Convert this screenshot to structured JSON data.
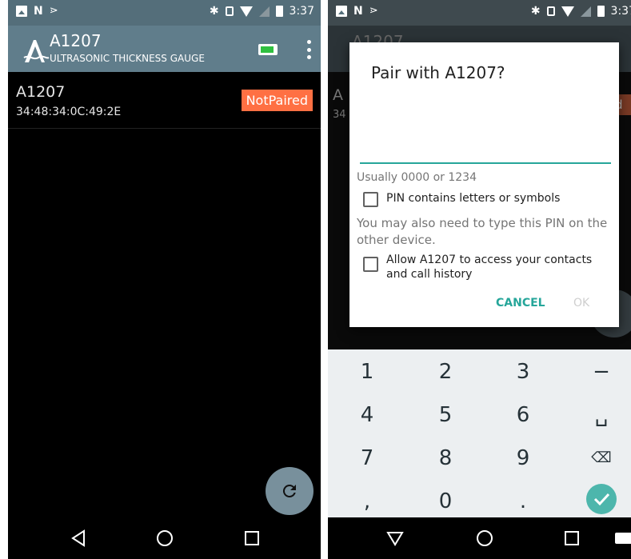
{
  "left": {
    "status": {
      "time": "3:37"
    },
    "app": {
      "title": "A1207",
      "subtitle": "ULTRASONIC THICKNESS GAUGE"
    },
    "device": {
      "name": "A1207",
      "mac": "34:48:34:0C:49:2E",
      "status": "NotPaired"
    },
    "icons": {
      "refresh": "refresh-icon",
      "menu": "more-vert-icon",
      "battery": "battery-icon"
    }
  },
  "right": {
    "status": {
      "time": "3:37"
    },
    "background": {
      "title": "A1207",
      "row_char": "A",
      "row_char2": "34",
      "badge_char": "d"
    },
    "dialog": {
      "title": "Pair with A1207?",
      "pin_value": "",
      "hint": "Usually 0000 or 1234",
      "letters_label": "PIN contains letters or symbols",
      "info": "You may also need to type this PIN on the other device.",
      "contacts_label": "Allow A1207 to access your contacts and call history",
      "cancel": "CANCEL",
      "ok": "OK"
    },
    "keypad": {
      "keys": [
        "1",
        "2",
        "3",
        "−",
        "4",
        "5",
        "6",
        "␣",
        "7",
        "8",
        "9",
        "⌫",
        ",",
        "0",
        ".",
        "✓"
      ]
    }
  },
  "colors": {
    "accent": "#26a69a",
    "badge": "#ff7043",
    "appbar": "#607d8b"
  }
}
